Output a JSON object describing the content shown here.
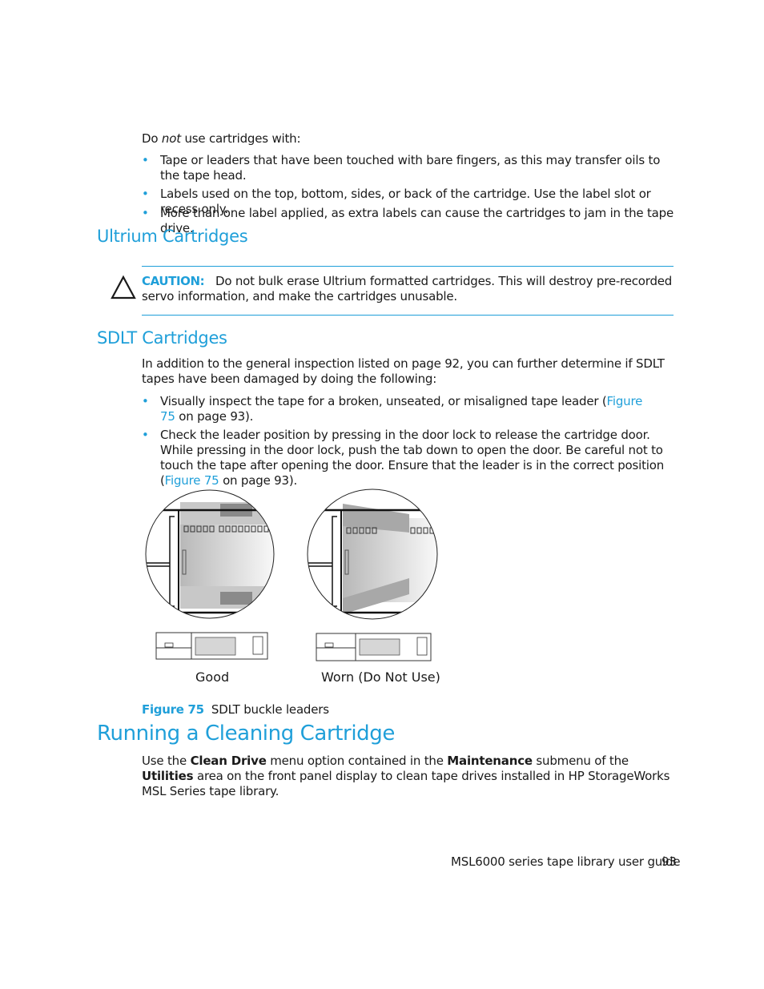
{
  "intro": {
    "prefix": "Do ",
    "emphasis": "not",
    "suffix": " use cartridges with:",
    "bullets": [
      "Tape or leaders that have been touched with bare fingers, as this may transfer oils to the tape head.",
      "Labels used on the top, bottom, sides, or back of the cartridge. Use the label slot or recess only.",
      "More than one label applied, as extra labels can cause the cartridges to jam in the tape drive."
    ]
  },
  "ultrium": {
    "heading": "Ultrium Cartridges",
    "caution_label": "CAUTION:",
    "caution_text": "Do not bulk erase Ultrium formatted cartridges. This will destroy pre-recorded servo information, and make the cartridges unusable.",
    "icon": "warning-triangle-icon"
  },
  "sdlt": {
    "heading": "SDLT Cartridges",
    "intro": "In addition to the general inspection listed on page 92, you can further determine if SDLT tapes have been damaged by doing the following:",
    "bullets": [
      {
        "before": "Visually inspect the tape for a broken, unseated, or misaligned tape leader (",
        "link": "Figure 75",
        "after": " on page 93)."
      },
      {
        "before": "Check the leader position by pressing in the door lock to release the cartridge door. While pressing in the door lock, push the tab down to open the door. Be careful not to touch the tape after opening the door. Ensure that the leader is in the correct position (",
        "link": "Figure 75",
        "after": " on page 93)."
      }
    ]
  },
  "figure": {
    "label_good": "Good",
    "label_worn": "Worn (Do Not Use)",
    "caption_number": "Figure 75",
    "caption_text": "SDLT buckle leaders"
  },
  "cleaning": {
    "heading": "Running a Cleaning Cartridge",
    "p1": "Use the ",
    "b1": "Clean Drive",
    "p2": " menu option contained in the ",
    "b2": "Maintenance",
    "p3": " submenu of the ",
    "b3": "Utilities",
    "p4": " area on the front panel display to clean tape drives installed in HP StorageWorks MSL Series tape library."
  },
  "footer": {
    "title": "MSL6000 series tape library user guide",
    "page_number": "93"
  },
  "colors": {
    "accent": "#1f9fd9",
    "text": "#1a1a1a"
  }
}
